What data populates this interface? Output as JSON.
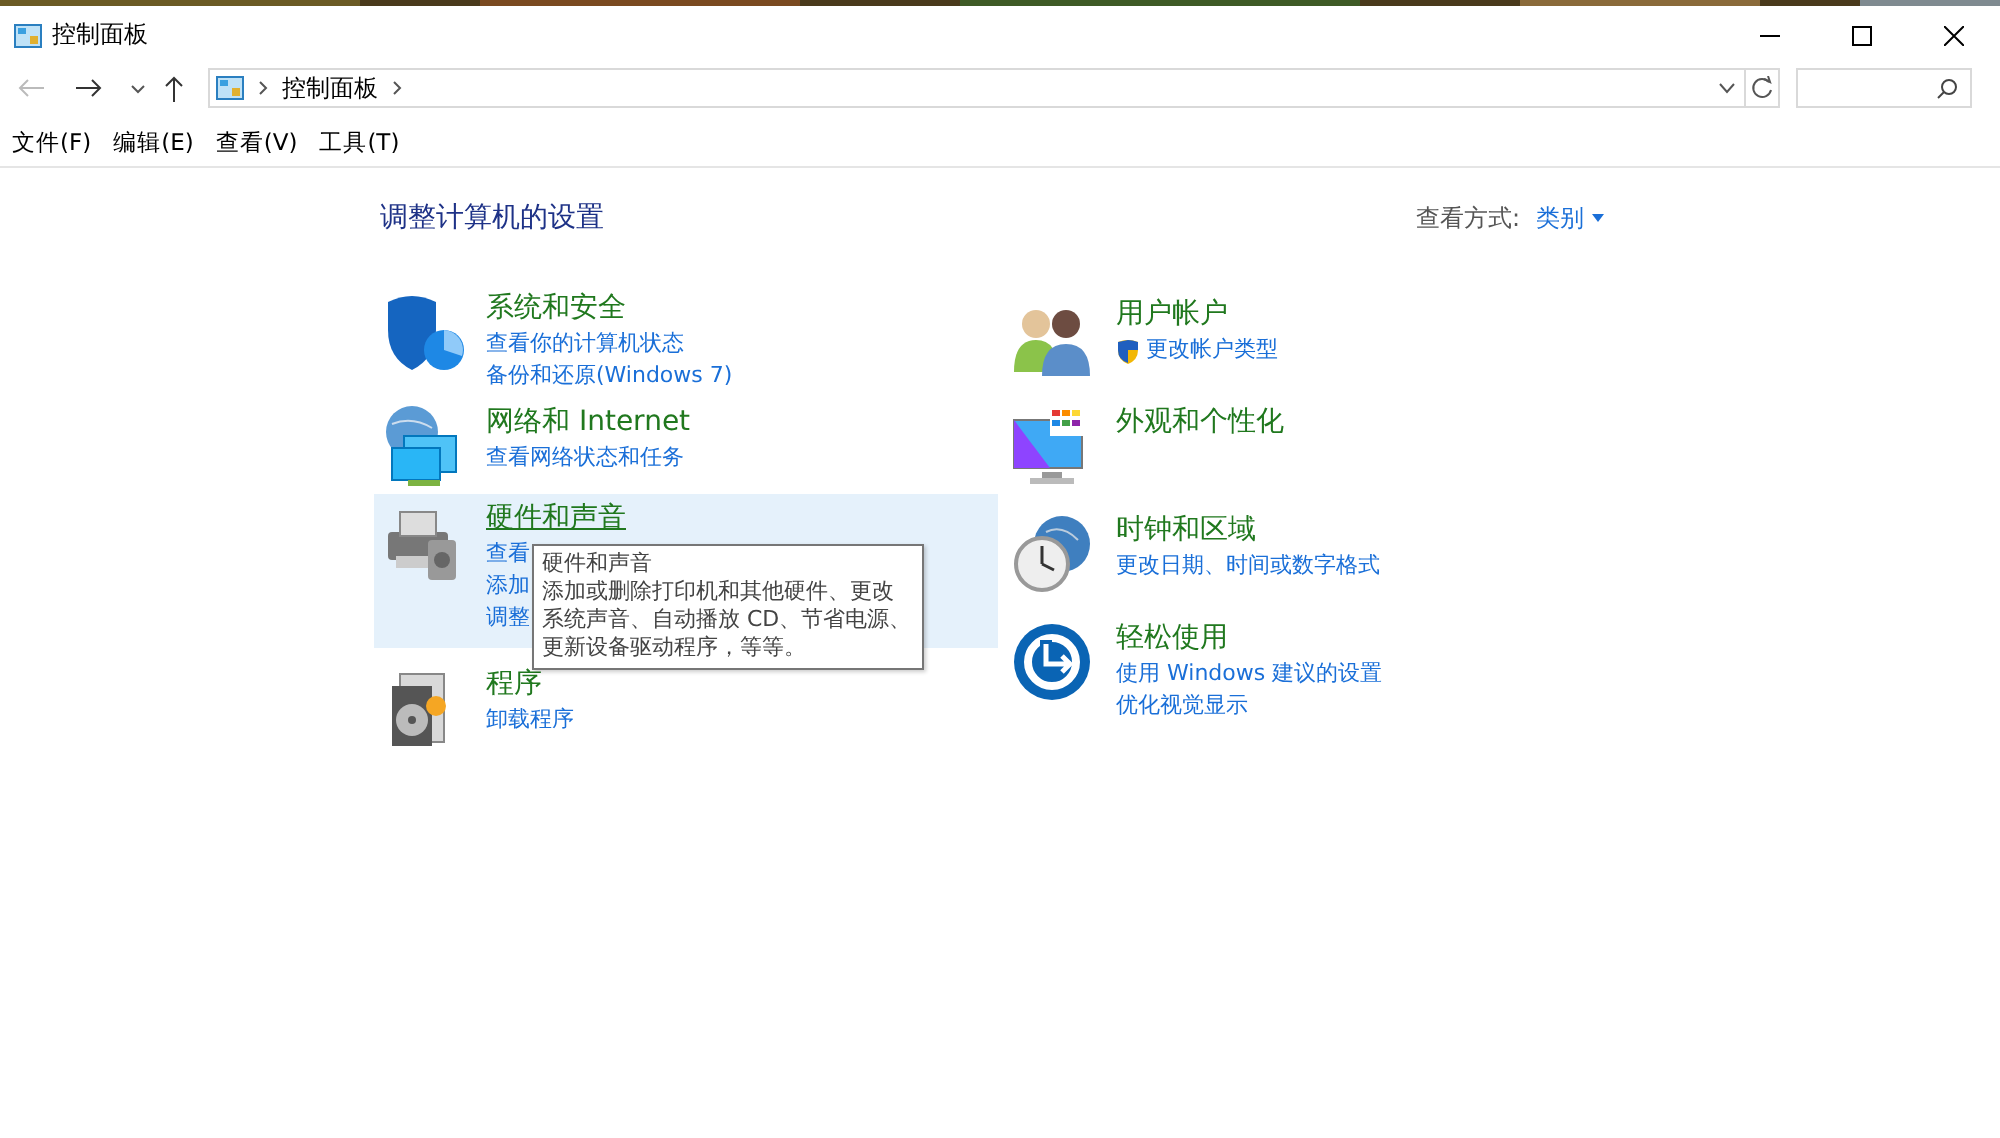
{
  "window": {
    "title": "控制面板"
  },
  "address": {
    "crumbs": [
      "控制面板"
    ]
  },
  "menu": [
    "文件(F)",
    "编辑(E)",
    "查看(V)",
    "工具(T)"
  ],
  "heading": "调整计算机的设置",
  "view_by": {
    "label": "查看方式:",
    "value": "类别"
  },
  "left": [
    {
      "title": "系统和安全",
      "hovered": false,
      "links": [
        {
          "text": "查看你的计算机状态",
          "shield": false
        },
        {
          "text": "备份和还原(Windows 7)",
          "shield": false
        }
      ]
    },
    {
      "title": "网络和 Internet",
      "hovered": false,
      "links": [
        {
          "text": "查看网络状态和任务",
          "shield": false
        }
      ]
    },
    {
      "title": "硬件和声音",
      "hovered": true,
      "links": [
        {
          "text": "查看",
          "shield": false
        },
        {
          "text": "添加",
          "shield": false
        },
        {
          "text": "调整",
          "shield": false
        }
      ]
    },
    {
      "title": "程序",
      "hovered": false,
      "links": [
        {
          "text": "卸载程序",
          "shield": false
        }
      ]
    }
  ],
  "right": [
    {
      "title": "用户帐户",
      "hovered": false,
      "links": [
        {
          "text": "更改帐户类型",
          "shield": true
        }
      ]
    },
    {
      "title": "外观和个性化",
      "hovered": false
    },
    {
      "title": "时钟和区域",
      "hovered": false,
      "links": [
        {
          "text": "更改日期、时间或数字格式",
          "shield": false
        }
      ]
    },
    {
      "title": "轻松使用",
      "hovered": false,
      "links": [
        {
          "text": "使用 Windows 建议的设置",
          "shield": false
        },
        {
          "text": "优化视觉显示",
          "shield": false
        }
      ]
    }
  ],
  "tooltip": {
    "title": "硬件和声音",
    "text": "添加或删除打印机和其他硬件、更改系统声音、自动播放 CD、节省电源、更新设备驱动程序，等等。"
  }
}
